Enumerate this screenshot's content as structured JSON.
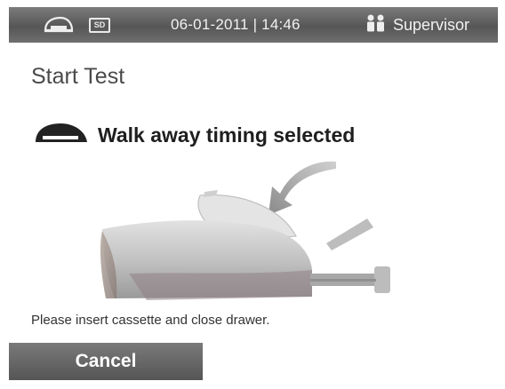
{
  "status_bar": {
    "icons": [
      "cassette-icon",
      "sd-card-icon",
      "user-icon"
    ],
    "sd_label": "SD",
    "datetime": "06-01-2011 | 14:46",
    "user": "Supervisor"
  },
  "screen": {
    "title": "Start Test",
    "timing_icon": "cassette-icon",
    "timing_label": "Walk away timing selected",
    "illustration": "analyzer-drawer-insert-cassette",
    "instruction": "Please insert cassette and close drawer."
  },
  "buttons": {
    "cancel": "Cancel"
  },
  "colors": {
    "status_bar": "#5d5d5d",
    "button": "#666666",
    "text_dark": "#1e1e1e"
  }
}
